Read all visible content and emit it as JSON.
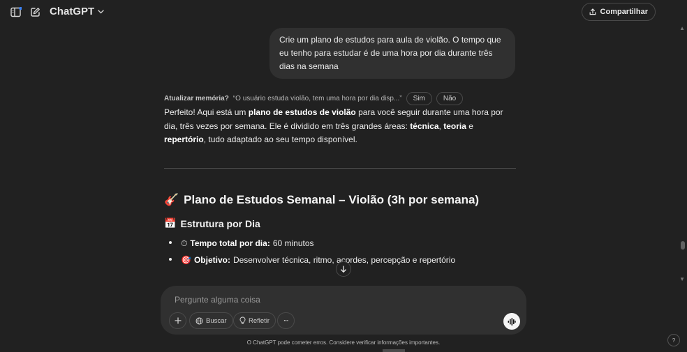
{
  "header": {
    "model_name": "ChatGPT",
    "share_label": "Compartilhar",
    "icons": [
      "sidebar-icon",
      "new-chat-icon",
      "chevron-down-icon",
      "share-icon"
    ]
  },
  "conversation": {
    "user_message": "Crie um plano de estudos para aula de violão. O tempo que eu tenho para estudar é de uma hora por dia durante três dias na semana",
    "memory_prompt": {
      "label": "Atualizar memória?",
      "text": "“O usuário estuda violão, tem uma hora por dia disp...”",
      "yes": "Sim",
      "no": "Não"
    },
    "intro": {
      "p1": "Perfeito! Aqui está um ",
      "b1": "plano de estudos de violão",
      "p2": " para você seguir durante uma hora por dia, três vezes por semana. Ele é dividido em três grandes áreas: ",
      "b2": "técnica",
      "p3": ", ",
      "b3": "teoria",
      "p4": " e ",
      "b4": "repertório",
      "p5": ", tudo adaptado ao seu tempo disponível."
    },
    "heading1": {
      "emoji": "🎸",
      "text": "Plano de Estudos Semanal – Violão (3h por semana)"
    },
    "heading2": {
      "emoji": "📅",
      "text": "Estrutura por Dia"
    },
    "list": [
      {
        "emoji": "⏱",
        "label": "Tempo total por dia:",
        "value": " 60 minutos"
      },
      {
        "emoji": "🎯",
        "label": "Objetivo:",
        "value": " Desenvolver técnica, ritmo, acordes, percepção e repertório"
      }
    ]
  },
  "composer": {
    "placeholder": "Pergunte alguma coisa",
    "search_label": "Buscar",
    "reason_label": "Refletir",
    "more_symbol": "···"
  },
  "footer": {
    "disclaimer": "O ChatGPT pode cometer erros. Considere verificar informações importantes.",
    "help": "?"
  },
  "colors": {
    "background": "#212121",
    "bubble": "#303030",
    "text": "#ececec",
    "muted": "#b4b4b4",
    "accent_dot": "#3b82f6"
  }
}
